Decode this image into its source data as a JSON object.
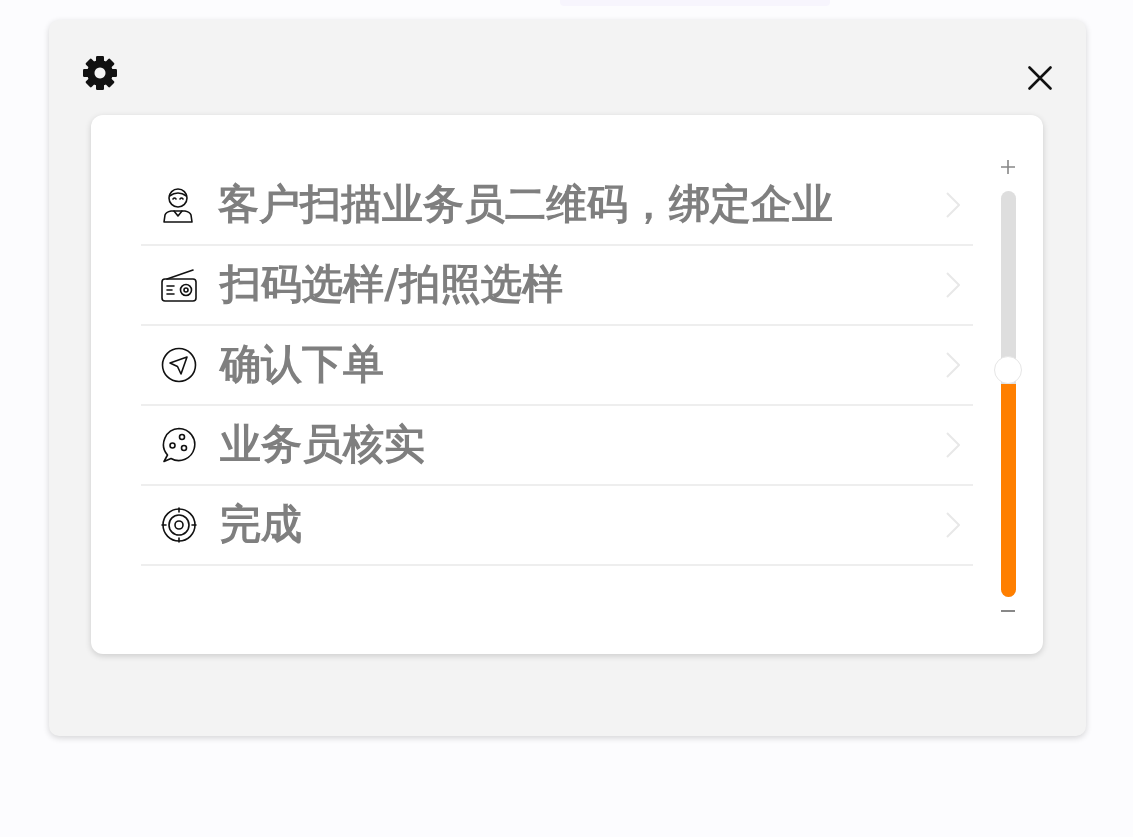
{
  "steps": [
    {
      "label": "客户扫描业务员二维码，绑定企业"
    },
    {
      "label": "扫码选样/拍照选样"
    },
    {
      "label": "确认下单"
    },
    {
      "label": "业务员核实"
    },
    {
      "label": "完成"
    }
  ],
  "slider": {
    "level": 0.56
  }
}
